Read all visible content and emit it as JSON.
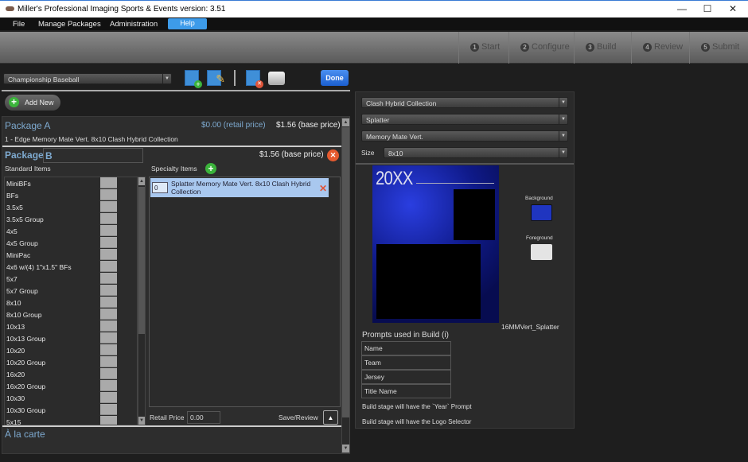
{
  "window": {
    "title": "Miller's Professional Imaging Sports & Events version: 3.51",
    "minimize": "—",
    "maximize": "☐",
    "close": "✕"
  },
  "menu": {
    "file": "File",
    "manage": "Manage Packages",
    "admin": "Administration",
    "help": "Help"
  },
  "steps": [
    {
      "n": "1",
      "label": "Start"
    },
    {
      "n": "2",
      "label": "Configure"
    },
    {
      "n": "3",
      "label": "Build"
    },
    {
      "n": "4",
      "label": "Review"
    },
    {
      "n": "5",
      "label": "Submit"
    }
  ],
  "toolbar": {
    "package_select": "Championship Baseball",
    "done": "Done",
    "add_new": "Add New"
  },
  "package_a": {
    "title": "Package A",
    "retail": "$0.00 (retail price)",
    "base": "$1.56 (base price)",
    "item": "1 - Edge Memory Mate Vert. 8x10 Clash Hybrid Collection"
  },
  "package_b": {
    "title": "Package",
    "name_value": "B",
    "base": "$1.56 (base price)",
    "standard_label": "Standard Items",
    "specialty_label": "Specialty Items",
    "standard_items": [
      "MiniBFs",
      "BFs",
      "3.5x5",
      "3.5x5 Group",
      "4x5",
      "4x5 Group",
      "MiniPac",
      "4x6 w/(4) 1\"x1.5\" BFs",
      "5x7",
      "5x7 Group",
      "8x10",
      "8x10 Group",
      "10x13",
      "10x13 Group",
      "10x20",
      "10x20 Group",
      "16x20",
      "16x20 Group",
      "10x30",
      "10x30 Group",
      "5x15"
    ],
    "specialty_items": [
      {
        "qty": "0",
        "name": "Splatter Memory Mate Vert. 8x10 Clash Hybrid Collection"
      }
    ],
    "retail_label": "Retail Price",
    "retail_value": "0.00",
    "save_review": "Save/Review"
  },
  "a_la_carte": "À la carte",
  "right": {
    "collection": "Clash Hybrid Collection",
    "style": "Splatter",
    "product": "Memory Mate Vert.",
    "size_label": "Size",
    "size": "8x10",
    "preview_year": "20XX",
    "template_name": "16MMVert_Splatter",
    "background_label": "Background",
    "foreground_label": "Foreground",
    "background_color": "#1f35c0",
    "foreground_color": "#e4e4e4",
    "prompts_title": "Prompts used in Build (i)",
    "prompts": [
      "Name",
      "Team",
      "Jersey",
      "Title Name"
    ],
    "note1": "Build stage will have the `Year` Prompt",
    "note2": "Build stage will have the Logo Selector"
  }
}
